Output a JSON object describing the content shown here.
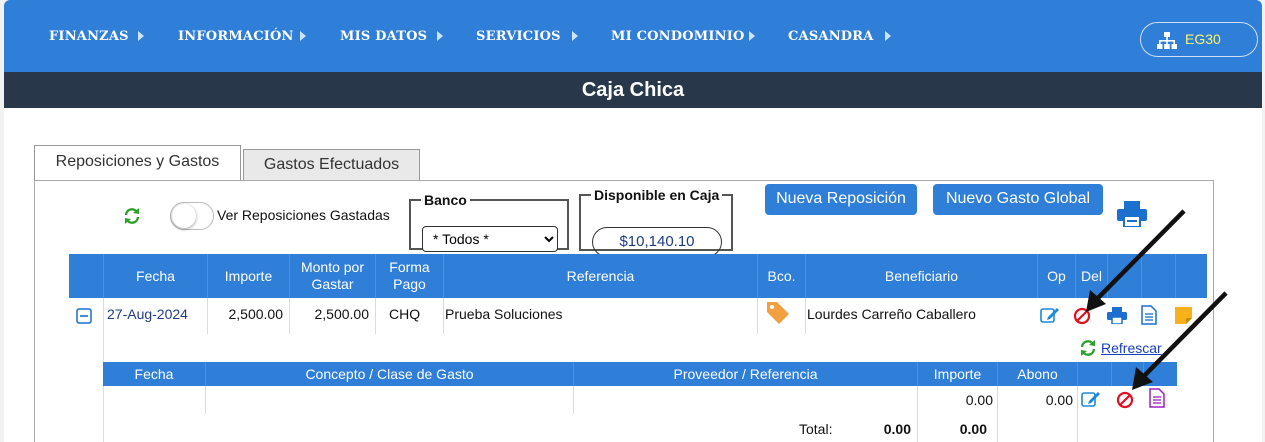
{
  "nav": {
    "items": [
      "FINANZAS",
      "INFORMACIÓN",
      "MIS DATOS",
      "SERVICIOS",
      "MI CONDOMINIO",
      "CASANDRA"
    ],
    "user_label": "EG30"
  },
  "page_title": "Caja Chica",
  "tabs": [
    "Reposiciones y Gastos",
    "Gastos Efectuados"
  ],
  "toolbar": {
    "toggle_label": "Ver Reposiciones Gastadas",
    "banco_legend": "Banco",
    "banco_selected": "* Todos *",
    "disponible_legend": "Disponible en Caja",
    "disponible_amount": "$10,140.10",
    "nueva_reposicion": "Nueva Reposición",
    "nuevo_gasto_global": "Nuevo Gasto Global"
  },
  "table": {
    "headers": {
      "fecha": "Fecha",
      "importe": "Importe",
      "monto": "Monto por Gastar",
      "forma": "Forma Pago",
      "referencia": "Referencia",
      "bco": "Bco.",
      "beneficiario": "Beneficiario",
      "op": "Op",
      "del": "Del"
    },
    "row": {
      "fecha": "27-Aug-2024",
      "importe": "2,500.00",
      "monto": "2,500.00",
      "forma": "CHQ",
      "referencia": "Prueba Soluciones",
      "beneficiario": "Lourdes Carreño Caballero"
    }
  },
  "subtable": {
    "refresh_label": "Refrescar",
    "headers": {
      "fecha": "Fecha",
      "concepto": "Concepto / Clase de Gasto",
      "proveedor": "Proveedor / Referencia",
      "importe": "Importe",
      "abono": "Abono"
    },
    "row": {
      "importe": "0.00",
      "abono": "0.00"
    },
    "total_label": "Total:",
    "total_importe": "0.00",
    "total_abono": "0.00"
  },
  "colors": {
    "nav_blue": "#2f7ed8",
    "title_dark": "#28384a",
    "user_text": "#fff36b",
    "delete_red": "#e0101e",
    "annotation_arrow": "#111111"
  }
}
